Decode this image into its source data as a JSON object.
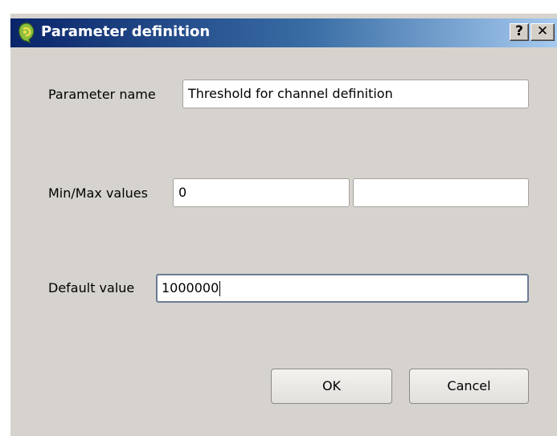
{
  "window": {
    "title": "Parameter definition",
    "icon": "qgis-logo-icon",
    "help_label": "?",
    "close_label": "✕"
  },
  "form": {
    "parameter_name_label": "Parameter name",
    "parameter_name_value": "Threshold for channel definition",
    "minmax_label": "Min/Max values",
    "min_value": "0",
    "max_value": "",
    "default_label": "Default value",
    "default_value": "1000000"
  },
  "buttons": {
    "ok_label": "OK",
    "cancel_label": "Cancel"
  }
}
